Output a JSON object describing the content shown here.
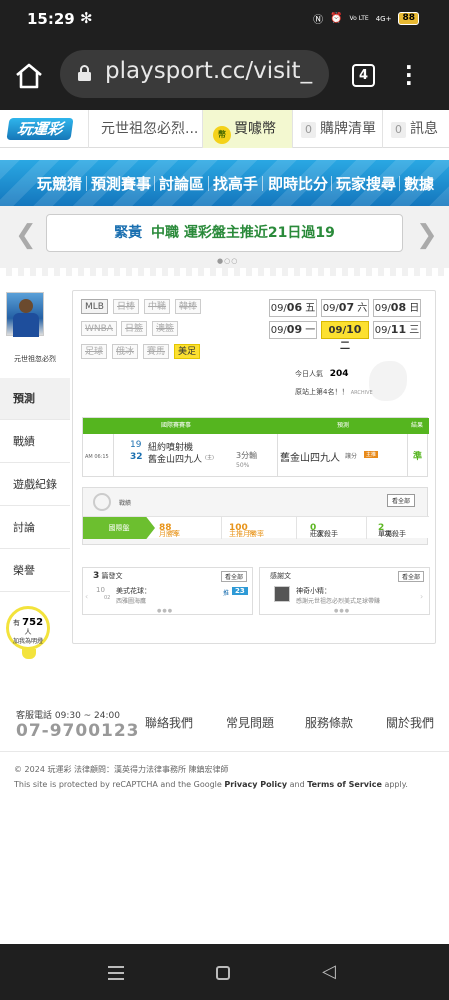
{
  "status": {
    "time": "15:29",
    "battery": "88",
    "signal_label": "4G+",
    "volte": "Vo LTE"
  },
  "browser": {
    "url": "playsport.cc/visit_",
    "tab_count": "4"
  },
  "site": {
    "logo": "玩運彩",
    "user_label": "元世祖忽必烈...",
    "buy_label": "買噱幣",
    "cart_count": "0",
    "cart_label": "購牌清單",
    "msg_count": "0",
    "msg_label": "訊息"
  },
  "nav": [
    "玩競猜",
    "預測賽事",
    "討論區",
    "找高手",
    "即時比分",
    "玩家搜尋",
    "數據"
  ],
  "ticker": {
    "tag": "緊黃",
    "text": "中職 運彩盤主推近21日過19"
  },
  "profile": {
    "name": "元世祖忽必烈"
  },
  "side_tabs": [
    "預測",
    "戰績",
    "遊戲紀錄",
    "討論",
    "榮譽"
  ],
  "helper": {
    "prefix": "有",
    "count": "752",
    "suffix": "人",
    "line2": "加我為明燈"
  },
  "leagues": {
    "row1": [
      "MLB",
      "日棒",
      "中職",
      "韓棒"
    ],
    "row2": [
      "WNBA",
      "日籃",
      "澳籃"
    ],
    "row3": [
      "足球",
      "俄冰",
      "賽馬",
      "美足"
    ]
  },
  "dates": [
    {
      "md": "09/",
      "day": "06",
      "wd": "五"
    },
    {
      "md": "09/",
      "day": "07",
      "wd": "六"
    },
    {
      "md": "09/",
      "day": "08",
      "wd": "日"
    },
    {
      "md": "09/",
      "day": "09",
      "wd": "一"
    },
    {
      "md": "09/",
      "day": "10",
      "wd": "二"
    },
    {
      "md": "09/",
      "day": "11",
      "wd": "三"
    }
  ],
  "popularity": {
    "label": "今日人氣",
    "value": "204",
    "rank_label": "原站上第4名！！",
    "rank_extra": "ARCHIVE"
  },
  "prediction": {
    "headers": {
      "game": "國際賽賽事",
      "pick": "預測",
      "result": "結果"
    },
    "time": "AM 06:15",
    "num1": "19",
    "num2": "32",
    "team1": "紐約噴射機",
    "team2": "舊金山四九人",
    "team2_note": "(主)",
    "spread": "3分輸",
    "spread_pct": "50%",
    "pick_team": "舊金山四九人",
    "pick_type": "讓分",
    "pick_badge": "主推",
    "result": "準"
  },
  "record": {
    "label": "戰績",
    "more": "看全部",
    "tag": "國際盤",
    "month_label": "月勝率",
    "month_val": "88",
    "month_unit": "%",
    "main_label": "主推月勝率",
    "main_val": "100",
    "main_unit": "%",
    "home_label": "莊家殺手",
    "home_val": "0",
    "home_unit": "次",
    "single_label": "單場殺手",
    "single_val": "2",
    "single_unit": "次"
  },
  "cards": {
    "left": {
      "count": "3",
      "label": "篇發文",
      "btn": "看全部",
      "num": "10",
      "num2": "02",
      "title": "美式花球：",
      "subtitle": "西雅圖海鷹",
      "badge_label": "推",
      "badge_val": "23"
    },
    "right": {
      "label": "感謝文",
      "btn": "看全部",
      "title": "神奇小精：",
      "subtitle": "感謝元世祖忽必烈美式足球帶賺"
    }
  },
  "footer": {
    "tel_label": "客服電話 09:30 ~ 24:00",
    "tel": "07-9700123",
    "links": [
      "聯絡我們",
      "常見問題",
      "服務條款",
      "關於我們"
    ],
    "copyright": "© 2024 玩運彩 法律顧問：漢英得力法律事務所 陳鎮宏律師",
    "recaptcha_pre": "This site is protected by reCAPTCHA and the Google ",
    "privacy": "Privacy Policy",
    "and": " and ",
    "terms": "Terms of Service",
    "apply": " apply."
  }
}
